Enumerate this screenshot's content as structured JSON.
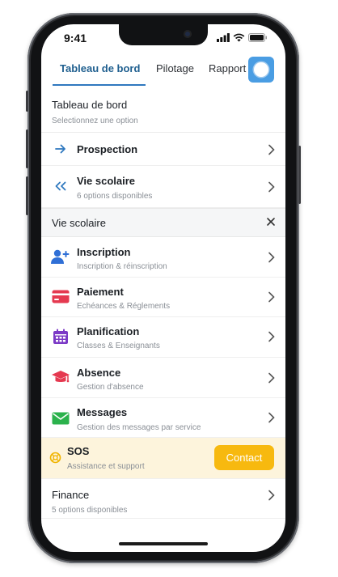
{
  "status_bar": {
    "time": "9:41"
  },
  "tabs": [
    {
      "label": "Tableau de bord",
      "active": true
    },
    {
      "label": "Pilotage",
      "active": false
    },
    {
      "label": "Rapport",
      "active": false
    }
  ],
  "header": {
    "title": "Tableau de bord",
    "subtitle": "Selectionnez une option"
  },
  "top_items": [
    {
      "title": "Prospection",
      "icon": "arrow-right-icon"
    },
    {
      "title": "Vie scolaire",
      "subtitle": "6 options disponibles",
      "icon": "double-chevron-left-icon"
    }
  ],
  "group": {
    "title": "Vie scolaire",
    "close_icon": "close-icon"
  },
  "group_items": [
    {
      "title": "Inscription",
      "subtitle": "Inscription & réinscription",
      "icon": "add-user-icon",
      "color": "#2f6fd6"
    },
    {
      "title": "Paiement",
      "subtitle": "Echéances & Réglements",
      "icon": "credit-card-icon",
      "color": "#e53950"
    },
    {
      "title": "Planification",
      "subtitle": "Classes & Enseignants",
      "icon": "calendar-icon",
      "color": "#7b39c6"
    },
    {
      "title": "Absence",
      "subtitle": "Gestion d'absence",
      "icon": "graduation-cap-icon",
      "color": "#e53950"
    },
    {
      "title": "Messages",
      "subtitle": "Gestion des messages par service",
      "icon": "envelope-icon",
      "color": "#2bb24c"
    }
  ],
  "sos": {
    "title": "SOS",
    "subtitle": "Assistance et support",
    "button": "Contact",
    "icon": "lifebuoy-icon",
    "color": "#f0b400"
  },
  "finance": {
    "title": "Finance",
    "subtitle": "5 options disponibles"
  },
  "colors": {
    "accent": "#2f78bf",
    "accent_text": "#1f5f8f",
    "warning": "#f7b90f",
    "sos_bg": "#fdf4dc"
  }
}
